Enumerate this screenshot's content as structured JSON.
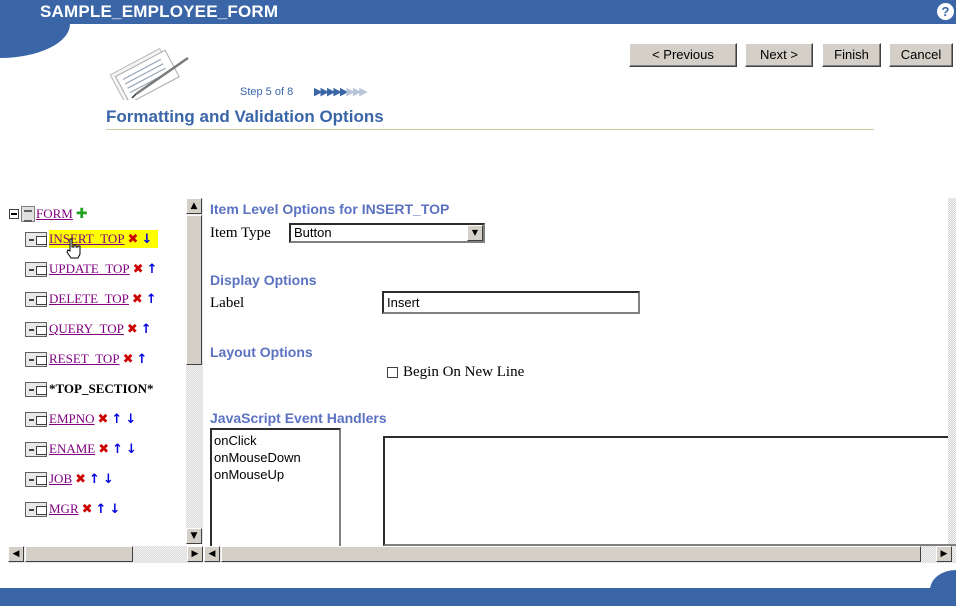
{
  "header": {
    "title": "SAMPLE_EMPLOYEE_FORM",
    "help_icon": "?"
  },
  "nav": {
    "previous": "< Previous",
    "next": "Next >",
    "finish": "Finish",
    "cancel": "Cancel"
  },
  "wizard": {
    "step_text": "Step 5 of 8",
    "steps_total": 8,
    "steps_current": 5,
    "title": "Formatting and Validation Options"
  },
  "tree": {
    "root_label": "FORM",
    "items": [
      {
        "label": "INSERT_TOP",
        "link": true,
        "selected": true,
        "icons": "x-down"
      },
      {
        "label": "UPDATE_TOP",
        "link": true,
        "selected": false,
        "icons": "x-partial"
      },
      {
        "label": "DELETE_TOP",
        "link": true,
        "selected": false,
        "icons": "x-up"
      },
      {
        "label": "QUERY_TOP",
        "link": true,
        "selected": false,
        "icons": "x-up"
      },
      {
        "label": "RESET_TOP",
        "link": true,
        "selected": false,
        "icons": "x-up"
      },
      {
        "label": "*TOP_SECTION*",
        "link": false,
        "selected": false,
        "icons": ""
      },
      {
        "label": "EMPNO",
        "link": true,
        "selected": false,
        "icons": "x-up-down"
      },
      {
        "label": "ENAME",
        "link": true,
        "selected": false,
        "icons": "x-up-down"
      },
      {
        "label": "JOB",
        "link": true,
        "selected": false,
        "icons": "x-up-down"
      },
      {
        "label": "MGR",
        "link": true,
        "selected": false,
        "icons": "x-up-down"
      }
    ]
  },
  "item_options": {
    "heading": "Item Level Options for INSERT_TOP",
    "item_type_label": "Item Type",
    "item_type_value": "Button"
  },
  "display_options": {
    "heading": "Display Options",
    "label_label": "Label",
    "label_value": "Insert"
  },
  "layout_options": {
    "heading": "Layout Options",
    "begin_on_new_line_label": "Begin On New Line",
    "begin_on_new_line_checked": false
  },
  "js_handlers": {
    "heading": "JavaScript Event Handlers",
    "events": [
      "onClick",
      "onMouseDown",
      "onMouseUp"
    ],
    "code": ""
  },
  "colors": {
    "brand": "#3a66a8",
    "section_heading": "#5a72c0",
    "selected_bg": "#ffff00",
    "link_visited": "#800080",
    "delete_icon": "#cc0000",
    "move_icon": "#0000e0",
    "add_icon": "#20a020"
  }
}
